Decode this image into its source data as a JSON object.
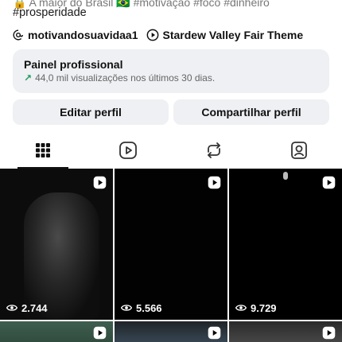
{
  "bio": {
    "line1_visible": "🔒 A maior do Brasil 🇧🇷 #motivação #foco #dinheiro",
    "line2": "#prosperidade"
  },
  "links": {
    "threads_handle": "motivandosuavidaa1",
    "music": "Stardew Valley Fair Theme"
  },
  "professional_panel": {
    "title": "Painel profissional",
    "stats": "44,0 mil visualizações nos últimos 30 dias."
  },
  "buttons": {
    "edit": "Editar perfil",
    "share": "Compartilhar perfil"
  },
  "tabs": [
    {
      "name": "grid",
      "active": true
    },
    {
      "name": "reels",
      "active": false
    },
    {
      "name": "reposts",
      "active": false
    },
    {
      "name": "tagged",
      "active": false
    }
  ],
  "reels": [
    {
      "views": "2.744"
    },
    {
      "views": "5.566"
    },
    {
      "views": "9.729"
    },
    {
      "views": ""
    },
    {
      "views": ""
    },
    {
      "views": ""
    }
  ],
  "colors": {
    "panel_bg": "#eef0f3",
    "trend_green": "#1f9a5a",
    "tile_bg": "#000000"
  }
}
